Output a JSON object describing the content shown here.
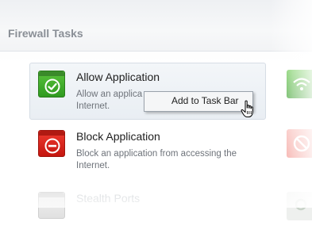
{
  "header": {
    "title": "Firewall Tasks"
  },
  "tasks": [
    {
      "title": "Allow Application",
      "description": "Allow an applica",
      "description_line2": "Internet.",
      "icon": "checkmark-icon",
      "color": "#3fa82a"
    },
    {
      "title": "Block Application",
      "description": "Block an application from accessing the",
      "description_line2": "Internet.",
      "icon": "block-icon",
      "color": "#d8231a"
    },
    {
      "title": "Stealth Ports",
      "icon": "stealth-ports-icon",
      "color": "#d7d7d7"
    }
  ],
  "context_menu": {
    "item": "Add to Task Bar"
  },
  "side_tiles": [
    "wifi-icon",
    "block-icon",
    "gear-icon"
  ]
}
